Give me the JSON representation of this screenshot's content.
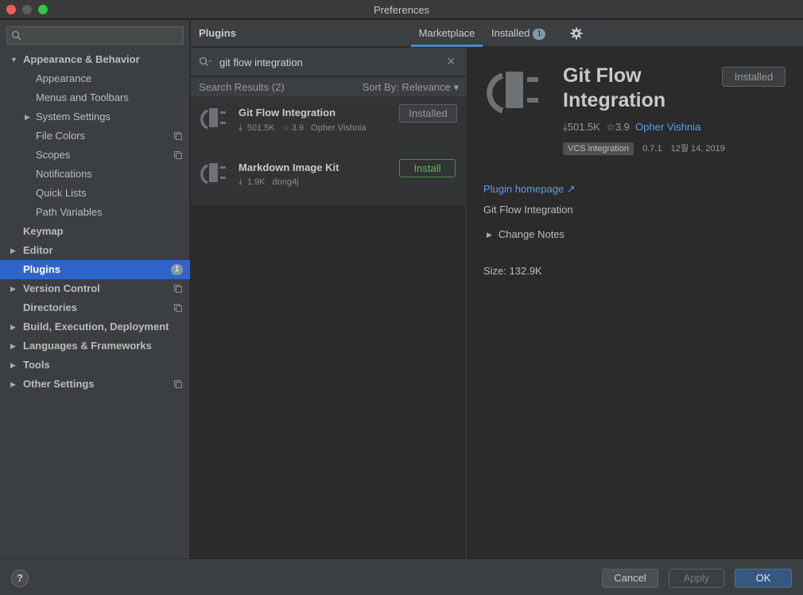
{
  "window": {
    "title": "Preferences"
  },
  "sidebar": {
    "search_placeholder": "",
    "items": [
      {
        "label": "Appearance & Behavior",
        "expanded": true
      },
      {
        "label": "Appearance"
      },
      {
        "label": "Menus and Toolbars"
      },
      {
        "label": "System Settings",
        "collapsed": true
      },
      {
        "label": "File Colors"
      },
      {
        "label": "Scopes"
      },
      {
        "label": "Notifications"
      },
      {
        "label": "Quick Lists"
      },
      {
        "label": "Path Variables"
      },
      {
        "label": "Keymap"
      },
      {
        "label": "Editor",
        "collapsed": true
      },
      {
        "label": "Plugins",
        "selected": true,
        "badge": "1"
      },
      {
        "label": "Version Control",
        "collapsed": true
      },
      {
        "label": "Directories"
      },
      {
        "label": "Build, Execution, Deployment",
        "collapsed": true
      },
      {
        "label": "Languages & Frameworks",
        "collapsed": true
      },
      {
        "label": "Tools",
        "collapsed": true
      },
      {
        "label": "Other Settings",
        "collapsed": true
      }
    ]
  },
  "header": {
    "title": "Plugins",
    "tabs": {
      "marketplace": "Marketplace",
      "installed": "Installed",
      "installed_count": "1"
    }
  },
  "plugin_search": {
    "query": "git flow integration",
    "clear": "✕"
  },
  "results": {
    "count_label": "Search Results (2)",
    "sort_label": "Sort By: Relevance ▾"
  },
  "plugins": [
    {
      "name": "Git Flow Integration",
      "downloads": "501.5K",
      "rating": "3.9",
      "vendor": "Opher Vishnia",
      "action": "Installed"
    },
    {
      "name": "Markdown Image Kit",
      "downloads": "1.9K",
      "vendor": "dong4j",
      "action": "Install"
    }
  ],
  "detail": {
    "name": "Git Flow Integration",
    "action": "Installed",
    "downloads": "501.5K",
    "rating": "3.9",
    "vendor": "Opher Vishnia",
    "tag": "VCS integration",
    "version": "0.7.1",
    "date": "12월 14, 2019",
    "homepage_label": "Plugin homepage ↗",
    "description": "Git Flow Integration",
    "change_notes": "Change Notes",
    "size": "Size: 132.9K"
  },
  "footer": {
    "help": "?",
    "cancel": "Cancel",
    "apply": "Apply",
    "ok": "OK"
  },
  "colors": {
    "accent": "#2f65ca",
    "link": "#589df6",
    "install_green": "#5cb85f",
    "ok_button": "#365880"
  }
}
